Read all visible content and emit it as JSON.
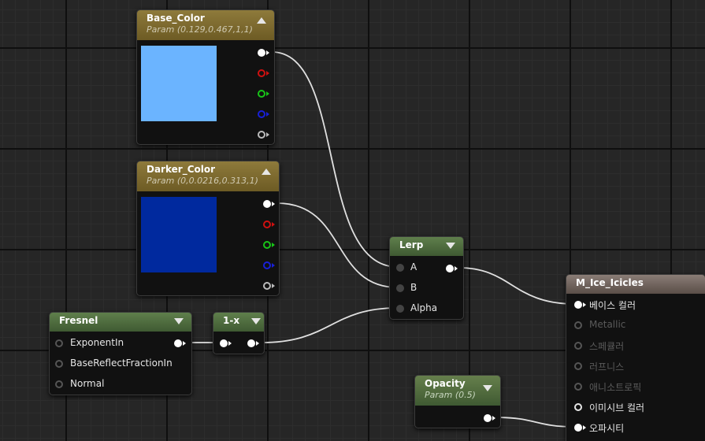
{
  "nodes": {
    "base_color": {
      "title": "Base_Color",
      "subtitle": "Param (0.129,0.467,1,1)",
      "swatch": "#6BB4FF"
    },
    "darker_color": {
      "title": "Darker_Color",
      "subtitle": "Param (0,0.0216,0.313,1)",
      "swatch": "#00299E"
    },
    "lerp": {
      "title": "Lerp",
      "inputs": [
        "A",
        "B",
        "Alpha"
      ]
    },
    "fresnel": {
      "title": "Fresnel",
      "inputs": [
        "ExponentIn",
        "BaseReflectFractionIn",
        "Normal"
      ]
    },
    "one_minus": {
      "title": "1-x"
    },
    "opacity": {
      "title": "Opacity",
      "subtitle": "Param (0.5)"
    },
    "material": {
      "title": "M_Ice_Icicles",
      "inputs": [
        "베이스 컬러",
        "Metallic",
        "스페큘러",
        "러프니스",
        "애니소트로픽",
        "이미시브 컬러",
        "오파시티"
      ]
    }
  },
  "colors": {
    "wire": "#E6E6E6",
    "param_header": "#8E7A3B",
    "function_header": "#5F7F4C",
    "result_header": "#8A7D76"
  }
}
